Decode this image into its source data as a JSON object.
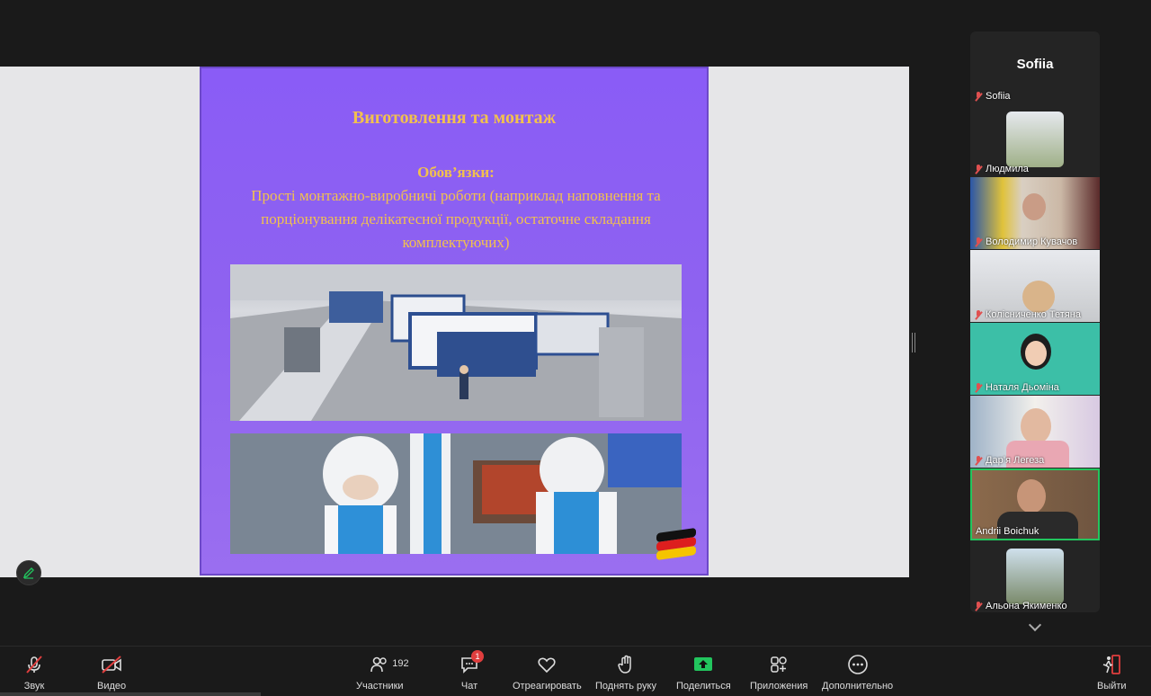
{
  "slide": {
    "title": "Виготовлення та монтаж",
    "duties_header": "Обов’язки:",
    "duties_text": "Прості монтажно-виробничі роботи (наприклад наповнення та порціонування делікатесної продукції, остаточне складання комплектуючих)"
  },
  "panel": {
    "header_name": "Sofiia",
    "participants": [
      {
        "name": "Sofiia",
        "muted": true
      },
      {
        "name": "Людмила",
        "muted": true
      },
      {
        "name": "Володимир Кувачов",
        "muted": true
      },
      {
        "name": "Колісниченко Тетяна",
        "muted": true
      },
      {
        "name": "Наталя Дьоміна",
        "muted": true
      },
      {
        "name": "Дар’я Легеза",
        "muted": true
      },
      {
        "name": "Andrii Boichuk",
        "muted": false,
        "active": true
      },
      {
        "name": "Альона Якименко",
        "muted": true
      }
    ]
  },
  "toolbar": {
    "audio": "Звук",
    "video": "Видео",
    "participants": "Участники",
    "participants_count": "192",
    "chat": "Чат",
    "chat_badge": "1",
    "react": "Отреагировать",
    "raise_hand": "Поднять руку",
    "share": "Поделиться",
    "apps": "Приложения",
    "more": "Дополнительно",
    "leave": "Выйти"
  },
  "colors": {
    "slide_purple": "#8a5cf6",
    "slide_text": "#f2c14e",
    "share_green": "#22c55e",
    "mute_red": "#e05050",
    "active_border": "#22c55e"
  }
}
